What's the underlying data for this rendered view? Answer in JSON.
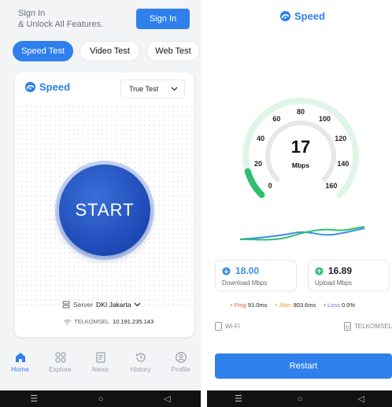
{
  "left": {
    "header": {
      "signin_text_line1": "Sign In",
      "signin_text_line2": "& Unlock All Features.",
      "signin_button": "Sign In"
    },
    "tabs": [
      {
        "label": "Speed Test",
        "active": true
      },
      {
        "label": "Video Test",
        "active": false
      },
      {
        "label": "Web Test",
        "active": false
      }
    ],
    "card": {
      "brand": "Speed",
      "test_select": "True Test",
      "start_label": "START",
      "server_label": "Server",
      "server_value": "DKI Jakarta",
      "isp": "TELKOMSEL",
      "ip": "10.191.235.143"
    },
    "bottom_nav": [
      {
        "label": "Home",
        "icon": "home-icon",
        "active": true
      },
      {
        "label": "Explore",
        "icon": "grid-icon",
        "active": false
      },
      {
        "label": "News",
        "icon": "news-icon",
        "active": false
      },
      {
        "label": "History",
        "icon": "history-icon",
        "active": false
      },
      {
        "label": "Profile",
        "icon": "profile-icon",
        "active": false
      }
    ]
  },
  "right": {
    "brand": "Speed",
    "gauge": {
      "ticks": [
        "0",
        "20",
        "40",
        "60",
        "80",
        "100",
        "120",
        "140",
        "160"
      ],
      "value": 17,
      "unit": "Mbps",
      "max": 160
    },
    "download": {
      "value": "18.00",
      "label": "Download Mbps"
    },
    "upload": {
      "value": "16.89",
      "label": "Upload Mbps"
    },
    "metrics": {
      "ping_label": "Ping",
      "ping_value": "91.0ms",
      "jitter_label": "Jitter",
      "jitter_value": "903.6ms",
      "loss_label": "Loss",
      "loss_value": "0.0%"
    },
    "connection": {
      "type": "Wi-Fi",
      "isp": "TELKOMSEL"
    },
    "restart_button": "Restart"
  },
  "colors": {
    "accent": "#2f80ed",
    "gauge_active": "#2fbf71",
    "gauge_track": "#dff5e8",
    "download": "#3b8fe8",
    "upload": "#2fbf71"
  }
}
